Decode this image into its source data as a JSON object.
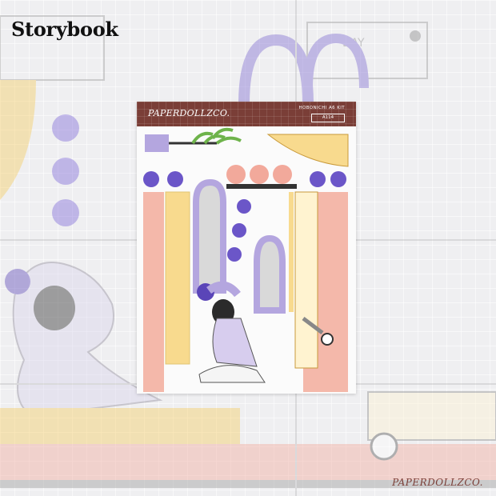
{
  "page": {
    "label": "Storybook"
  },
  "sheet": {
    "brand": "PAPERDOLLZCO.",
    "kit_name": "HOBONICHI A6 KIT",
    "kit_code": "A114"
  },
  "footer": {
    "brand": "PAPERDOLLZCO."
  },
  "colors": {
    "header": "#7a3e37",
    "lavender": "#b4a6df",
    "purple": "#6b56c8",
    "peach": "#f2a99b",
    "yellow": "#f8da8e",
    "pink": "#f4b8aa"
  }
}
